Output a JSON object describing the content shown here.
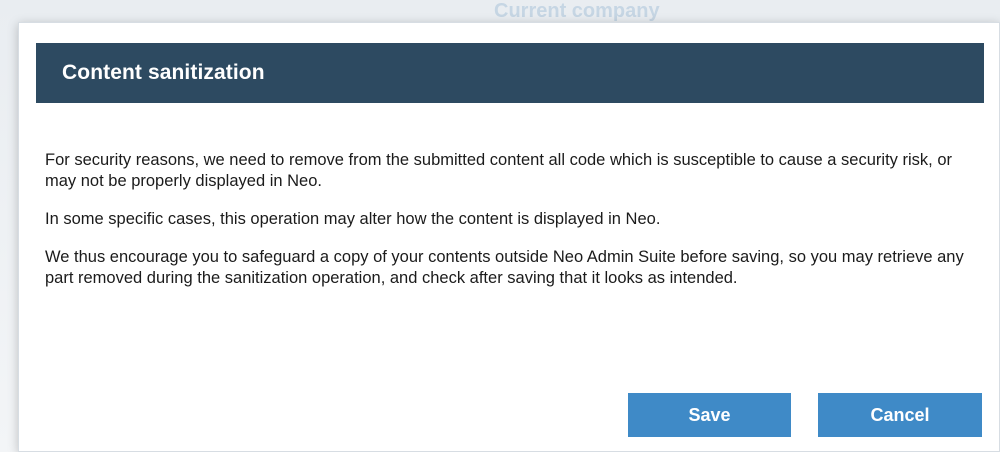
{
  "background": {
    "label": "Current company"
  },
  "dialog": {
    "title": "Content sanitization",
    "paragraphs": [
      "For security reasons, we need to remove from the submitted content all code which is susceptible to cause a security risk, or may not be properly displayed in Neo.",
      "In some specific cases, this operation may alter how the content is displayed in Neo.",
      "We thus encourage you to safeguard a copy of your contents outside Neo Admin Suite before saving, so you may retrieve any part removed during the sanitization operation, and check after saving that it looks as intended."
    ],
    "buttons": {
      "save": "Save",
      "cancel": "Cancel"
    }
  },
  "colors": {
    "header_bg": "#2d4a61",
    "button_bg": "#3f8ac7",
    "text": "#1b1b1b"
  }
}
